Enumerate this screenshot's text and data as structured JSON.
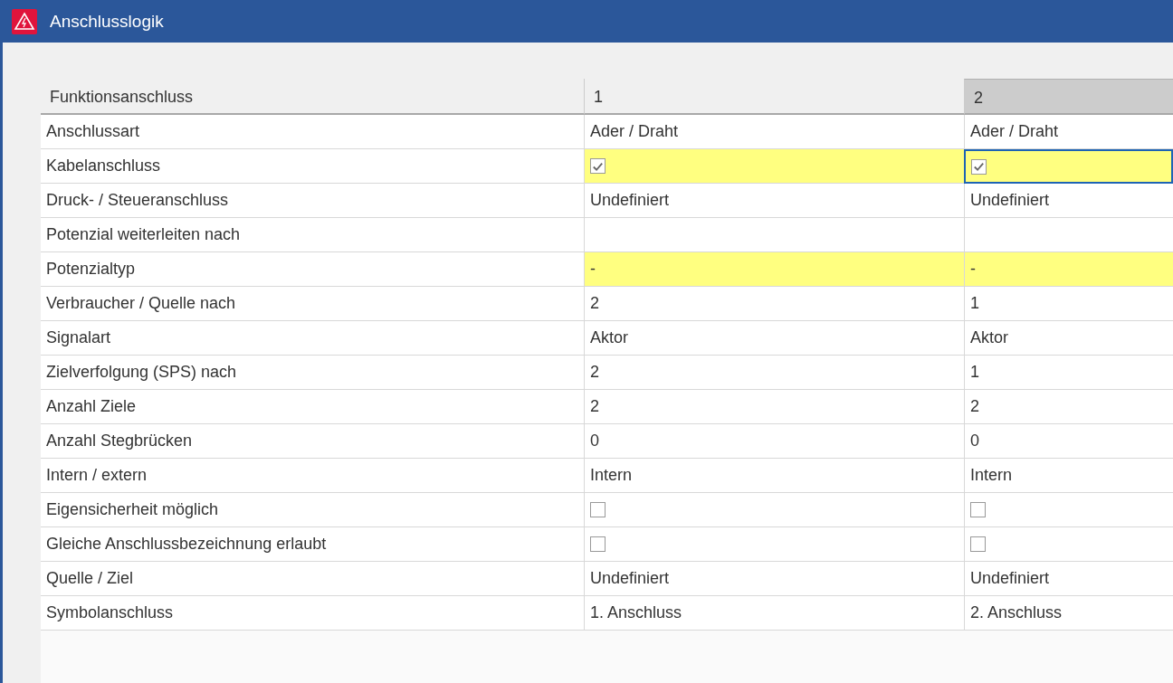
{
  "window": {
    "title": "Anschlusslogik"
  },
  "table": {
    "header": "Funktionsanschluss",
    "columns": [
      {
        "label": "1",
        "selected": false
      },
      {
        "label": "2",
        "selected": true
      }
    ],
    "rows": [
      {
        "label": "Anschlussart",
        "kind": "text",
        "highlighted": false,
        "cells": [
          {
            "value": "Ader / Draht",
            "focused": false
          },
          {
            "value": "Ader / Draht",
            "focused": false
          }
        ]
      },
      {
        "label": "Kabelanschluss",
        "kind": "checkbox",
        "highlighted": true,
        "cells": [
          {
            "checked": true,
            "focused": false
          },
          {
            "checked": true,
            "focused": true
          }
        ]
      },
      {
        "label": "Druck- / Steueranschluss",
        "kind": "text",
        "highlighted": false,
        "cells": [
          {
            "value": "Undefiniert",
            "focused": false
          },
          {
            "value": "Undefiniert",
            "focused": false
          }
        ]
      },
      {
        "label": "Potenzial weiterleiten nach",
        "kind": "text",
        "highlighted": false,
        "cells": [
          {
            "focused": false
          },
          {
            "focused": false
          }
        ]
      },
      {
        "label": "Potenzialtyp",
        "kind": "text",
        "highlighted": true,
        "cells": [
          {
            "value": "-",
            "focused": false
          },
          {
            "value": "-",
            "focused": false
          }
        ]
      },
      {
        "label": "Verbraucher / Quelle nach",
        "kind": "text",
        "highlighted": false,
        "cells": [
          {
            "value": "2",
            "focused": false
          },
          {
            "value": "1",
            "focused": false
          }
        ]
      },
      {
        "label": "Signalart",
        "kind": "text",
        "highlighted": false,
        "cells": [
          {
            "value": "Aktor",
            "focused": false
          },
          {
            "value": "Aktor",
            "focused": false
          }
        ]
      },
      {
        "label": "Zielverfolgung (SPS) nach",
        "kind": "text",
        "highlighted": false,
        "cells": [
          {
            "value": "2",
            "focused": false
          },
          {
            "value": "1",
            "focused": false
          }
        ]
      },
      {
        "label": "Anzahl Ziele",
        "kind": "text",
        "highlighted": false,
        "cells": [
          {
            "value": "2",
            "focused": false
          },
          {
            "value": "2",
            "focused": false
          }
        ]
      },
      {
        "label": "Anzahl Stegbrücken",
        "kind": "text",
        "highlighted": false,
        "cells": [
          {
            "value": "0",
            "focused": false
          },
          {
            "value": "0",
            "focused": false
          }
        ]
      },
      {
        "label": "Intern / extern",
        "kind": "text",
        "highlighted": false,
        "cells": [
          {
            "value": "Intern",
            "focused": false
          },
          {
            "value": "Intern",
            "focused": false
          }
        ]
      },
      {
        "label": "Eigensicherheit möglich",
        "kind": "checkbox",
        "highlighted": false,
        "cells": [
          {
            "checked": false,
            "focused": false
          },
          {
            "checked": false,
            "focused": false
          }
        ]
      },
      {
        "label": "Gleiche Anschlussbezeichnung erlaubt",
        "kind": "checkbox",
        "highlighted": false,
        "cells": [
          {
            "checked": false,
            "focused": false
          },
          {
            "checked": false,
            "focused": false
          }
        ]
      },
      {
        "label": "Quelle / Ziel",
        "kind": "text",
        "highlighted": false,
        "cells": [
          {
            "value": "Undefiniert",
            "focused": false
          },
          {
            "value": "Undefiniert",
            "focused": false
          }
        ]
      },
      {
        "label": "Symbolanschluss",
        "kind": "text",
        "highlighted": false,
        "cells": [
          {
            "value": "1. Anschluss",
            "focused": false
          },
          {
            "value": "2. Anschluss",
            "focused": false
          }
        ]
      }
    ]
  }
}
